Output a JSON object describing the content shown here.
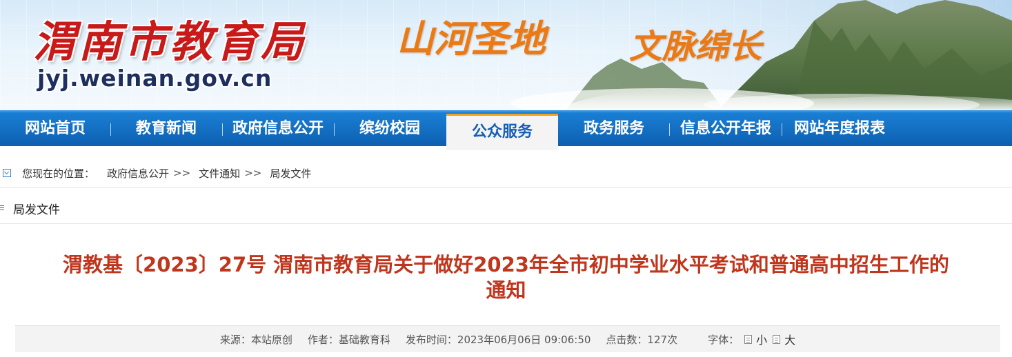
{
  "banner": {
    "title": "渭南市教育局",
    "domain": "jyj.weinan.gov.cn",
    "slogan_part1": "山河圣地",
    "slogan_part2": "文脉绵长"
  },
  "nav": {
    "items": [
      {
        "label": "网站首页"
      },
      {
        "label": "教育新闻"
      },
      {
        "label": "政府信息公开"
      },
      {
        "label": "缤纷校园"
      },
      {
        "label": "公众服务"
      },
      {
        "label": "政务服务"
      },
      {
        "label": "信息公开年报"
      },
      {
        "label": "网站年度报表"
      }
    ],
    "active_index": 4
  },
  "breadcrumb": {
    "prefix": "您现在的位置：",
    "items": [
      "政府信息公开",
      "文件通知",
      "局发文件"
    ],
    "separator": ">>"
  },
  "section": {
    "title": "局发文件"
  },
  "article": {
    "title_line1": "渭教基〔2023〕27号 渭南市教育局关于做好2023年全市初中学业水平考试和普通高中招生工作的",
    "title_line2": "通知"
  },
  "meta": {
    "source": "来源：本站原创",
    "author": "作者：基础教育科",
    "published": "发布时间：2023年06月06日 09:06:50",
    "clicks": "点击数：127次",
    "font_label": "字体：",
    "font_small": "小",
    "font_large": "大"
  },
  "colors": {
    "nav_blue": "#0d5fb0",
    "title_red": "#c0361c",
    "banner_title_red": "#c91a1a",
    "slogan_orange": "#ec7a14",
    "active_tab_accent": "#f3a21b"
  }
}
